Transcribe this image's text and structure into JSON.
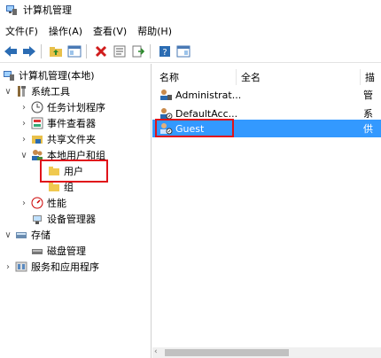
{
  "window": {
    "title": "计算机管理"
  },
  "menu": [
    "文件(F)",
    "操作(A)",
    "查看(V)",
    "帮助(H)"
  ],
  "toolbar": [
    "back-icon",
    "forward-icon",
    "up-folder-icon",
    "show-hide-tree-icon",
    "delete-icon",
    "properties-icon",
    "export-list-icon",
    "help-icon",
    "console-icon"
  ],
  "tree": {
    "root": "计算机管理(本地)",
    "system_tools": "系统工具",
    "task_scheduler": "任务计划程序",
    "event_viewer": "事件查看器",
    "shared_folders": "共享文件夹",
    "local_users_groups": "本地用户和组",
    "users": "用户",
    "groups": "组",
    "performance": "性能",
    "device_manager": "设备管理器",
    "storage": "存储",
    "disk_management": "磁盘管理",
    "services_apps": "服务和应用程序"
  },
  "list": {
    "columns": [
      "名称",
      "全名",
      "描"
    ],
    "rows": [
      {
        "name": "Administrat...",
        "full": "",
        "desc": "管"
      },
      {
        "name": "DefaultAcc...",
        "full": "",
        "desc": "系"
      },
      {
        "name": "Guest",
        "full": "",
        "desc": "供"
      }
    ]
  },
  "colors": {
    "selection": "#3399ff",
    "highlight_box": "#e0131a"
  }
}
